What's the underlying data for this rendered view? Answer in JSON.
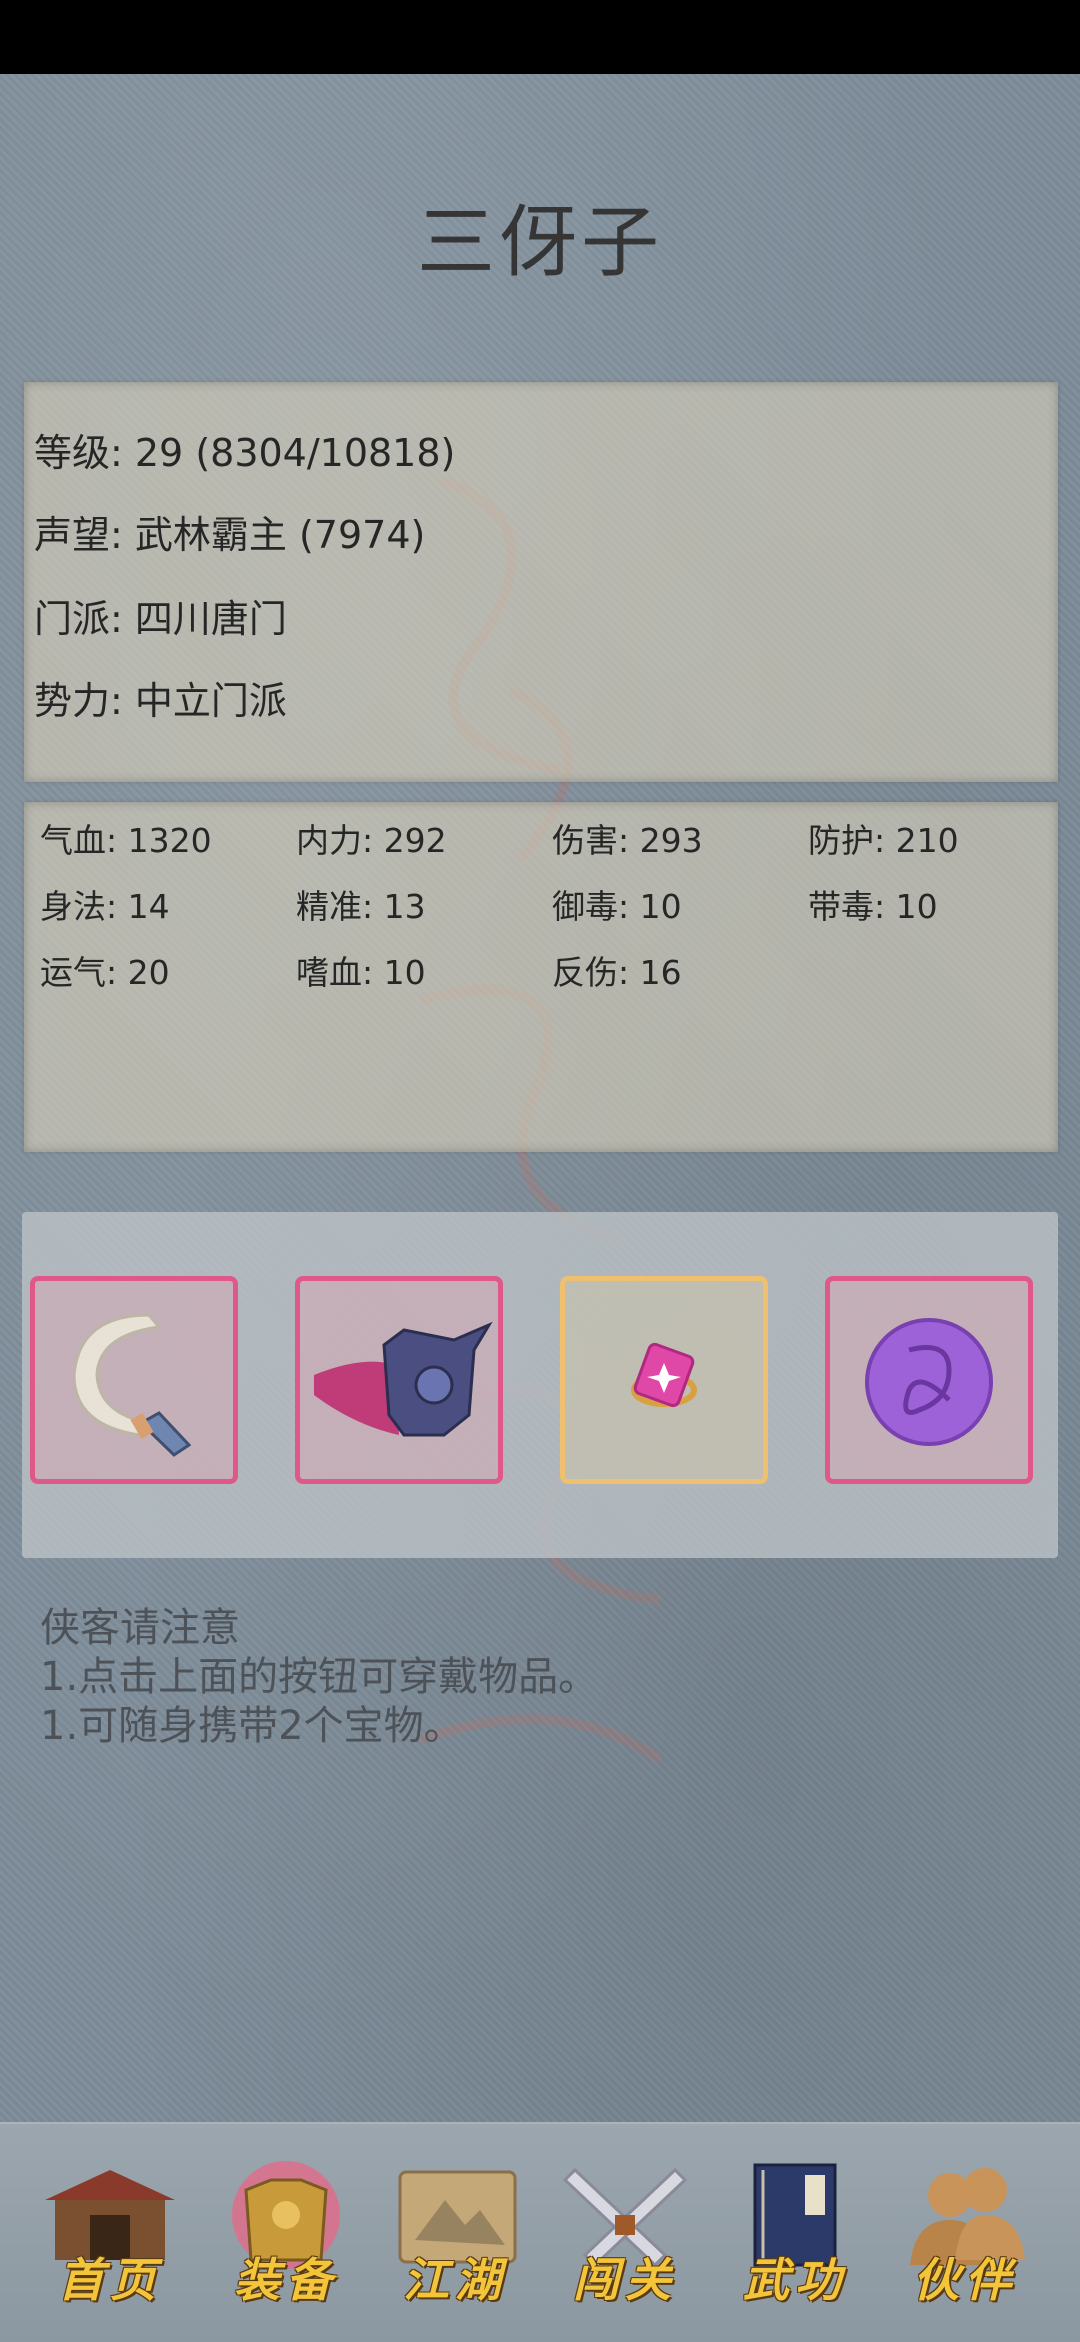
{
  "character": {
    "name": "三伢子",
    "level": "等级: 29 (8304/10818)",
    "reputation": "声望: 武林霸主 (7974)",
    "sect": "门派: 四川唐门",
    "faction": "势力:  中立门派"
  },
  "stats": [
    "气血: 1320",
    "内力: 292",
    "伤害: 293",
    "防护: 210",
    "身法: 14",
    "精准: 13",
    "御毒: 10",
    "带毒: 10",
    "运气: 20",
    "嗜血: 10",
    "反伤: 16"
  ],
  "equipment": [
    {
      "icon": "curved-blade-icon",
      "rarity_color": "#e0588a"
    },
    {
      "icon": "caped-armor-icon",
      "rarity_color": "#e0588a"
    },
    {
      "icon": "pink-ring-icon",
      "rarity_color": "#eec070"
    },
    {
      "icon": "purple-orb-icon",
      "rarity_color": "#e0588a"
    }
  ],
  "notice": {
    "title": "侠客请注意",
    "line1": "1.点击上面的按钮可穿戴物品。",
    "line2": "1.可随身携带2个宝物。"
  },
  "nav": [
    {
      "label": "首页",
      "icon": "home-house-icon"
    },
    {
      "label": "装备",
      "icon": "armor-equipment-icon"
    },
    {
      "label": "江湖",
      "icon": "scroll-map-icon"
    },
    {
      "label": "闯关",
      "icon": "crossed-swords-icon"
    },
    {
      "label": "武功",
      "icon": "book-icon"
    },
    {
      "label": "伙伴",
      "icon": "partners-icon"
    }
  ],
  "colors": {
    "rare_border": "#e0588a",
    "gold_border": "#eec070",
    "nav_label": "#f3c53a"
  }
}
